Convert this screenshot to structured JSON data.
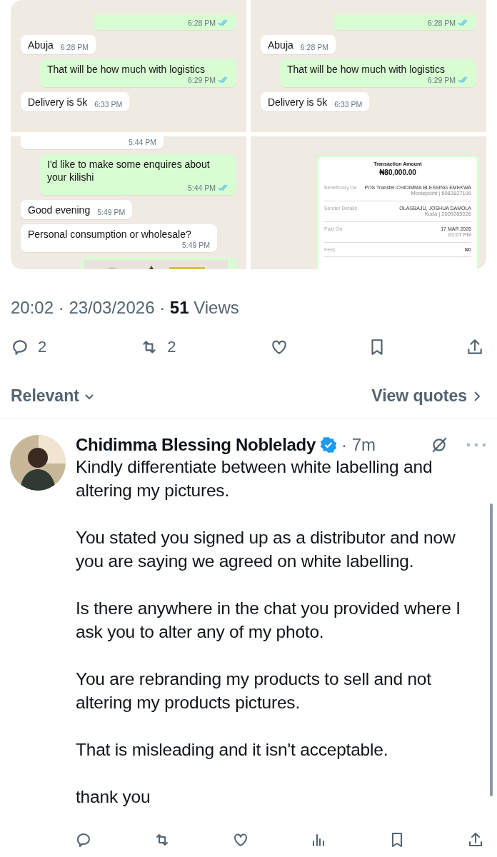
{
  "media": [
    {
      "kind": "chat",
      "messages": [
        {
          "kind": "sent",
          "time": "6:28 PM",
          "read": true,
          "cut": true
        },
        {
          "kind": "received",
          "text": "Abuja",
          "time": "6:28 PM"
        },
        {
          "kind": "sent",
          "text": "That will be how much with logistics",
          "time": "6:29 PM",
          "read": true
        },
        {
          "kind": "received",
          "text": "Delivery is 5k",
          "time": "6:33 PM"
        }
      ]
    },
    {
      "kind": "chat",
      "messages": [
        {
          "kind": "sent",
          "time": "6:28 PM",
          "read": true,
          "cut": true
        },
        {
          "kind": "received",
          "text": "Abuja",
          "time": "6:28 PM"
        },
        {
          "kind": "sent",
          "text": "That will be how much with logistics",
          "time": "6:29 PM",
          "read": true
        },
        {
          "kind": "received",
          "text": "Delivery is 5k",
          "time": "6:33 PM"
        }
      ]
    },
    {
      "kind": "chat",
      "messages": [
        {
          "kind": "received",
          "time": "5:44 PM",
          "cut": true
        },
        {
          "kind": "sent",
          "text": "I'd like to make some enquires about your kilishi",
          "time": "5:44 PM",
          "read": true
        },
        {
          "kind": "received",
          "text": "Good evening",
          "time": "5:49 PM"
        },
        {
          "kind": "received",
          "text": "Personal consumption or wholesale?",
          "time": "5:49 PM"
        },
        {
          "kind": "picture"
        }
      ]
    },
    {
      "kind": "receipt",
      "title": "Transaction Amount",
      "amount": "₦80,000.00",
      "rows": [
        {
          "label": "Beneficiary De",
          "value": "POS Transfer-CHIDIMMA BLESSING EMEKWA",
          "sub": "Moniepoint | 5082827199"
        },
        {
          "label": "Sender Details",
          "value": "OLAGBAJU, JOSHUA DAMOLA",
          "sub": "Kuda | 2009265026"
        },
        {
          "label": "Paid On",
          "value": "17 MAR 2026",
          "sub": "01:07 PM"
        },
        {
          "label": "Fees",
          "value": "₦0"
        }
      ]
    }
  ],
  "meta": "20:02 · 23/03/2026 · **51** Views",
  "actions": [
    {
      "kind": "reply",
      "count": "2"
    },
    {
      "kind": "repost",
      "count": "2"
    },
    {
      "kind": "like"
    },
    {
      "kind": "bookmark"
    },
    {
      "kind": "share"
    }
  ],
  "sort": {
    "label": "Relevant",
    "quotes": "View quotes"
  },
  "reply": {
    "name": "Chidimma Blessing Noblelady",
    "verified": true,
    "age": "· 7m",
    "paragraphs": [
      "Kindly differentiate between white labelling and altering my pictures.",
      "You stated you signed up as a distributor and now you are saying we agreed on white labelling.",
      "Is there anywhere in the chat you provided where I ask you to alter any of my photo.",
      "You are rebranding my products to sell and not altering my products pictures.",
      "That is misleading and it isn't acceptable.",
      "thank you"
    ],
    "actions": [
      {
        "kind": "reply"
      },
      {
        "kind": "repost"
      },
      {
        "kind": "like"
      },
      {
        "kind": "views"
      },
      {
        "kind": "bookmark"
      },
      {
        "kind": "share"
      }
    ]
  }
}
